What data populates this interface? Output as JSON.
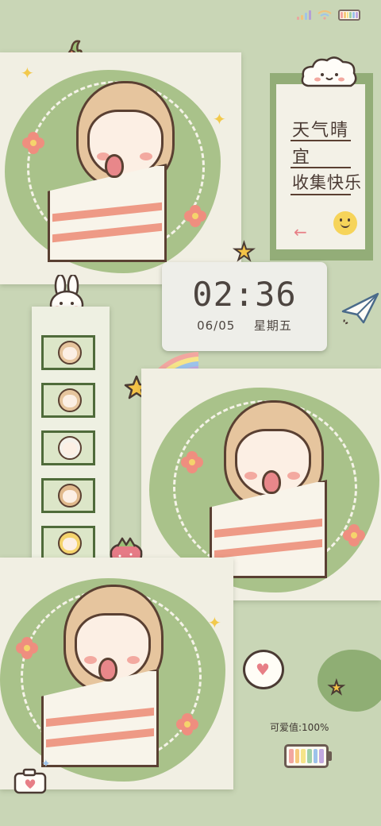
{
  "status_bar": {
    "signal_icon": "signal-bars-icon",
    "wifi_icon": "wifi-icon",
    "battery_icon": "rainbow-battery-icon"
  },
  "memo": {
    "line1": "天气晴",
    "line2": "宜",
    "line3": "收集快乐",
    "arrow": "←",
    "smile_icon": "smiley-face-icon"
  },
  "clock": {
    "time": "02:36",
    "date": "06/05",
    "weekday": "星期五"
  },
  "widget": {
    "lovely_label": "可爱值:",
    "lovely_value": "100%",
    "battery_level": 1.0
  },
  "decor": {
    "carrot": "carrot-icon",
    "cloud": "cloud-face-icon",
    "rabbit": "rabbit-icon",
    "plane": "paper-plane-icon",
    "rainbow": "rainbow-star-icon",
    "strawberry": "strawberry-icon",
    "speech": "heart-speech-bubble-icon",
    "camera": "camera-icon"
  },
  "colors": {
    "background": "#c9d6b6",
    "paper": "#f1efe3",
    "blob_green": "#a9c28a",
    "hair": "#e6c59e",
    "stripe": "#ee9a86",
    "heart": "#e77f86"
  }
}
